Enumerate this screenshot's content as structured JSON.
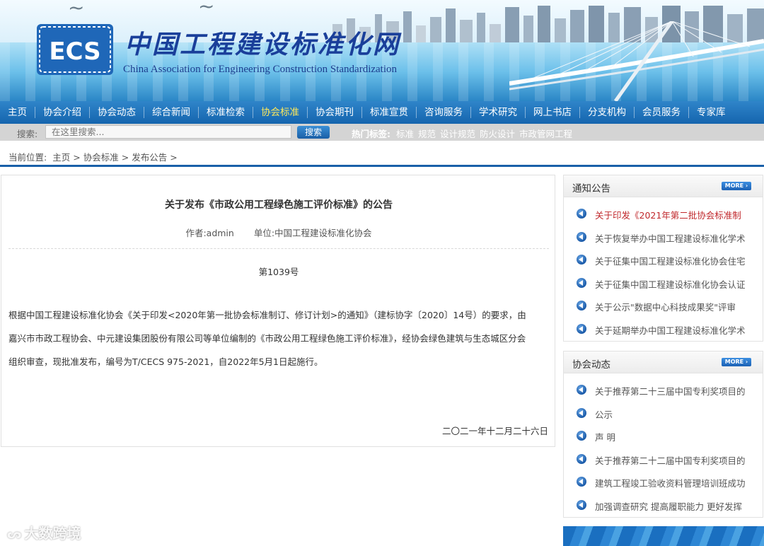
{
  "header": {
    "logo_text": "ECS",
    "title": "中国工程建设标准化网",
    "subtitle": "China Association for Engineering Construction Standardization"
  },
  "nav": {
    "items": [
      {
        "label": "主页"
      },
      {
        "label": "协会介绍"
      },
      {
        "label": "协会动态"
      },
      {
        "label": "综合新闻"
      },
      {
        "label": "标准检索"
      },
      {
        "label": "协会标准",
        "active": true
      },
      {
        "label": "协会期刊"
      },
      {
        "label": "标准宣贯"
      },
      {
        "label": "咨询服务"
      },
      {
        "label": "学术研究"
      },
      {
        "label": "网上书店"
      },
      {
        "label": "分支机构"
      },
      {
        "label": "会员服务"
      },
      {
        "label": "专家库"
      }
    ]
  },
  "search": {
    "label": "搜索:",
    "placeholder": "在这里搜索...",
    "button": "搜索",
    "hot_label": "热门标签:",
    "hot_tags": [
      "标准",
      "规范",
      "设计规范",
      "防火设计",
      "市政管网工程"
    ]
  },
  "breadcrumb": {
    "prefix": "当前位置:",
    "items": [
      "主页",
      "协会标准",
      "发布公告"
    ],
    "sep": ">"
  },
  "article": {
    "title": "关于发布《市政公用工程绿色施工评价标准》的公告",
    "author": "作者:admin",
    "unit": "单位:中国工程建设标准化协会",
    "number": "第1039号",
    "body_lines": [
      "根据中国工程建设标准化协会《关于印发<2020年第一批协会标准制订、修订计划>的通知》（建标协字〔2020〕14号）的要求，由",
      "嘉兴市市政工程协会、中元建设集团股份有限公司等单位编制的《市政公用工程绿色施工评价标准》，经协会绿色建筑与生态城区分会",
      "组织审查，现批准发布，编号为T/CECS 975-2021，自2022年5月1日起施行。"
    ],
    "date": "二〇二一年十二月二十六日"
  },
  "sidebar": {
    "notices": {
      "title": "通知公告",
      "more": "MORE",
      "items": [
        {
          "text": "关于印发《2021年第二批协会标准制",
          "highlight": true
        },
        {
          "text": "关于恢复举办中国工程建设标准化学术"
        },
        {
          "text": "关于征集中国工程建设标准化协会住宅"
        },
        {
          "text": "关于征集中国工程建设标准化协会认证"
        },
        {
          "text": "关于公示\"数据中心科技成果奖\"评审"
        },
        {
          "text": "关于延期举办中国工程建设标准化学术"
        }
      ]
    },
    "news": {
      "title": "协会动态",
      "more": "MORE",
      "items": [
        {
          "text": "关于推荐第二十三届中国专利奖项目的"
        },
        {
          "text": "公示"
        },
        {
          "text": "声  明"
        },
        {
          "text": "关于推荐第二十二届中国专利奖项目的"
        },
        {
          "text": "建筑工程竣工验收资料管理培训班成功"
        },
        {
          "text": "加强调查研究 提高履职能力 更好发挥"
        }
      ]
    }
  },
  "watermark": "大数跨境",
  "colors": {
    "nav_bg": "#1a6ab4",
    "nav_active": "#ffe95a",
    "accent": "#1a60a8",
    "highlight": "#c0282c"
  }
}
